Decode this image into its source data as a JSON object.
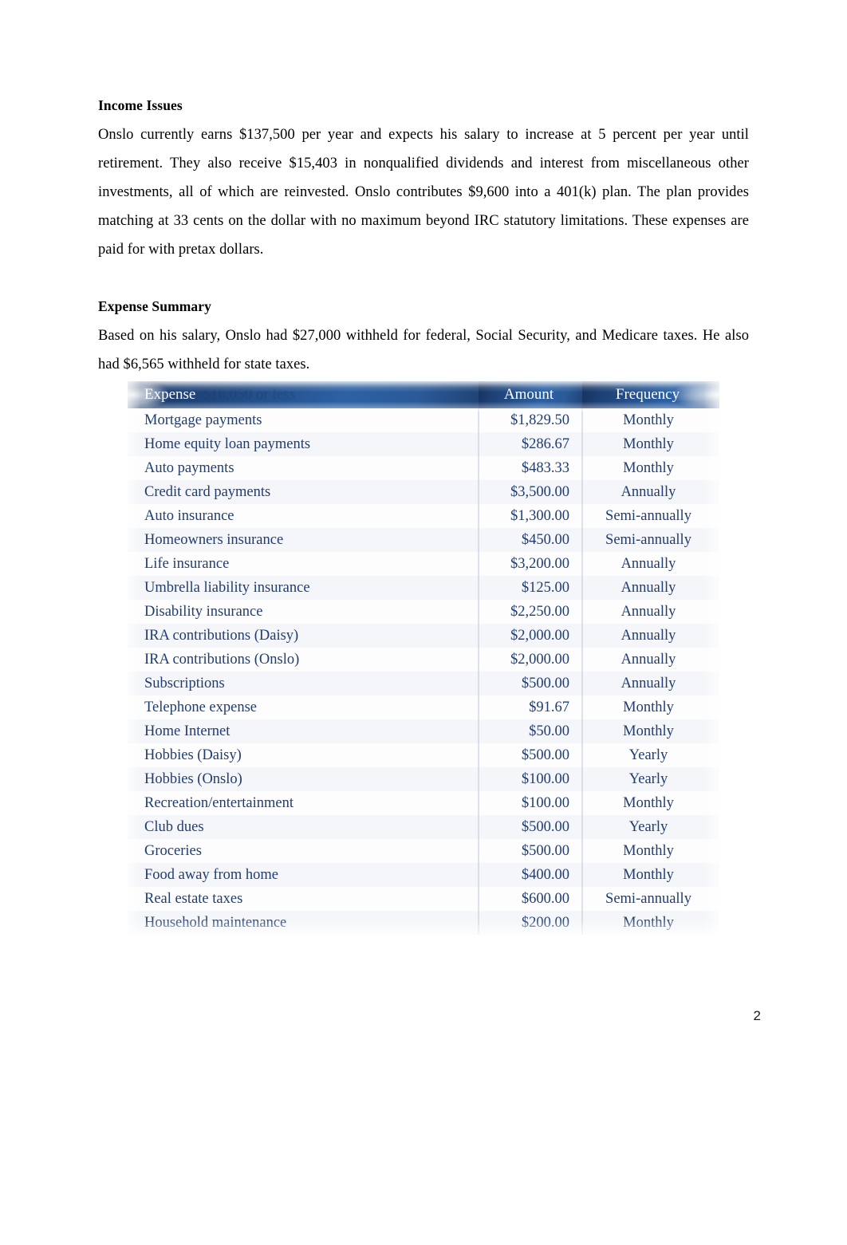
{
  "document": {
    "page_number": "2"
  },
  "sections": [
    {
      "heading": "Income Issues",
      "paragraph": "Onslo currently earns $137,500 per year and expects his salary to increase at 5 percent per year until retirement. They also receive $15,403 in nonqualified dividends and interest from miscellaneous other investments, all of which are reinvested. Onslo contributes $9,600 into a 401(k) plan. The plan provides matching at 33 cents on the dollar with no maximum beyond IRC statutory limitations. These expenses are paid for with pretax dollars."
    },
    {
      "heading": "Expense Summary",
      "paragraph": "Based on his salary, Onslo had $27,000 withheld for federal, Social Security, and Medicare taxes. He also had $6,565 withheld for state taxes."
    }
  ],
  "expense_table": {
    "header": {
      "expense": "Expense",
      "ghost_text": "$16,050 or less",
      "amount": "Amount",
      "frequency": "Frequency"
    },
    "colors": {
      "header_gradient_start": "#16305e",
      "header_gradient_end": "#2c61a4",
      "header_text": "#ffffff",
      "body_text": "#1f3d73",
      "row_stripe": "#f4f6f9"
    },
    "rows": [
      {
        "expense": "Mortgage payments",
        "amount": "$1,829.50",
        "frequency": "Monthly"
      },
      {
        "expense": "Home equity loan payments",
        "amount": "$286.67",
        "frequency": "Monthly"
      },
      {
        "expense": "Auto payments",
        "amount": "$483.33",
        "frequency": "Monthly"
      },
      {
        "expense": "Credit card payments",
        "amount": "$3,500.00",
        "frequency": "Annually"
      },
      {
        "expense": "Auto insurance",
        "amount": "$1,300.00",
        "frequency": "Semi-annually"
      },
      {
        "expense": "Homeowners insurance",
        "amount": "$450.00",
        "frequency": "Semi-annually"
      },
      {
        "expense": "Life insurance",
        "amount": "$3,200.00",
        "frequency": "Annually"
      },
      {
        "expense": "Umbrella liability insurance",
        "amount": "$125.00",
        "frequency": "Annually"
      },
      {
        "expense": "Disability insurance",
        "amount": "$2,250.00",
        "frequency": "Annually"
      },
      {
        "expense": "IRA contributions (Daisy)",
        "amount": "$2,000.00",
        "frequency": "Annually"
      },
      {
        "expense": "IRA contributions (Onslo)",
        "amount": "$2,000.00",
        "frequency": "Annually"
      },
      {
        "expense": "Subscriptions",
        "amount": "$500.00",
        "frequency": "Annually"
      },
      {
        "expense": "Telephone expense",
        "amount": "$91.67",
        "frequency": "Monthly"
      },
      {
        "expense": "Home Internet",
        "amount": "$50.00",
        "frequency": "Monthly"
      },
      {
        "expense": "Hobbies (Daisy)",
        "amount": "$500.00",
        "frequency": "Yearly"
      },
      {
        "expense": "Hobbies (Onslo)",
        "amount": "$100.00",
        "frequency": "Yearly"
      },
      {
        "expense": "Recreation/entertainment",
        "amount": "$100.00",
        "frequency": "Monthly"
      },
      {
        "expense": "Club dues",
        "amount": "$500.00",
        "frequency": "Yearly"
      },
      {
        "expense": "Groceries",
        "amount": "$500.00",
        "frequency": "Monthly"
      },
      {
        "expense": "Food away from home",
        "amount": "$400.00",
        "frequency": "Monthly"
      },
      {
        "expense": "Real estate taxes",
        "amount": "$600.00",
        "frequency": "Semi-annually"
      },
      {
        "expense": "Household maintenance",
        "amount": "$200.00",
        "frequency": "Monthly"
      }
    ]
  }
}
